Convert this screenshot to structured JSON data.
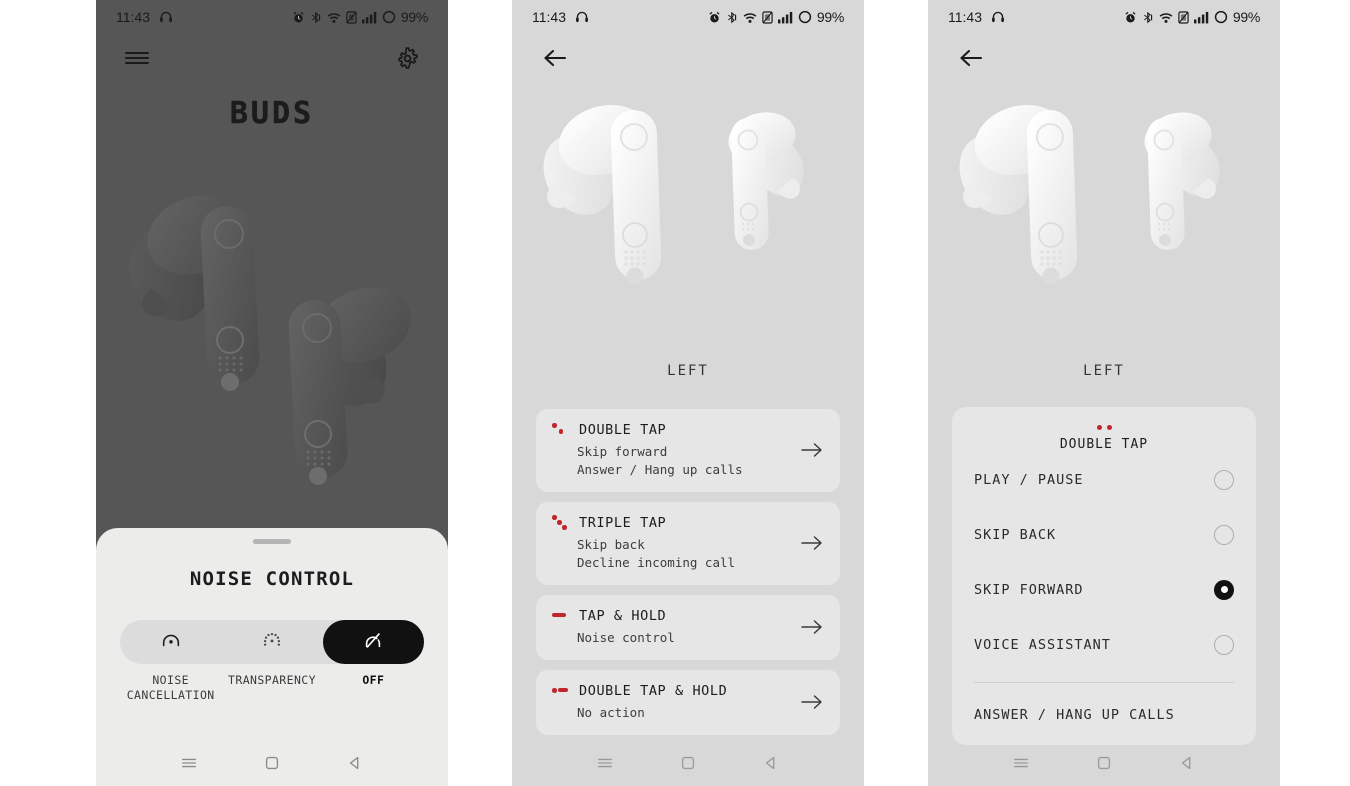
{
  "status_bar": {
    "time": "11:43",
    "battery": "99%",
    "icons": [
      "headphones-icon",
      "alarm-icon",
      "bluetooth-icon",
      "wifi-icon",
      "nfc-icon",
      "signal-icon",
      "battery-ring-icon"
    ]
  },
  "colors": {
    "dark_bg": "#565656",
    "light_bg": "#d8d8d8",
    "card_bg": "#e6e6e6",
    "sheet_bg": "#ececeb",
    "accent_red": "#c0262b",
    "selected_black": "#111111"
  },
  "panel1": {
    "menu_icon": "hamburger-menu-icon",
    "settings_icon": "gear-icon",
    "logo": "BUDS",
    "product_image": "earbuds-pair-image",
    "sheet": {
      "title": "NOISE CONTROL",
      "options": [
        {
          "label": "NOISE CANCELLATION",
          "icon": "noise-cancellation-icon",
          "selected": false
        },
        {
          "label": "TRANSPARENCY",
          "icon": "transparency-icon",
          "selected": false
        },
        {
          "label": "OFF",
          "icon": "noise-off-icon",
          "selected": true
        }
      ]
    }
  },
  "panel2": {
    "back_icon": "arrow-left-icon",
    "product_image": "earbuds-pair-image",
    "bud_label": "LEFT",
    "gestures": [
      {
        "title": "DOUBLE TAP",
        "lines": [
          "Skip forward",
          "Answer / Hang up calls"
        ],
        "icon": "two-dots-icon",
        "dots": 2,
        "hold": false,
        "arrow": "arrow-right-icon"
      },
      {
        "title": "TRIPLE TAP",
        "lines": [
          "Skip back",
          "Decline incoming call"
        ],
        "icon": "three-dots-icon",
        "dots": 3,
        "hold": false,
        "arrow": "arrow-right-icon"
      },
      {
        "title": "TAP & HOLD",
        "lines": [
          "Noise control"
        ],
        "icon": "dot-dash-icon",
        "dots": 0,
        "hold": true,
        "arrow": "arrow-right-icon"
      },
      {
        "title": "DOUBLE TAP & HOLD",
        "lines": [
          "No action"
        ],
        "icon": "dot-dot-dash-icon",
        "dots": 1,
        "hold": true,
        "arrow": "arrow-right-icon"
      }
    ]
  },
  "panel3": {
    "back_icon": "arrow-left-icon",
    "product_image": "earbuds-pair-image",
    "bud_label": "LEFT",
    "card": {
      "title": "DOUBLE TAP",
      "icon": "two-dots-icon",
      "options": [
        {
          "label": "PLAY / PAUSE",
          "selected": false
        },
        {
          "label": "SKIP BACK",
          "selected": false
        },
        {
          "label": "SKIP FORWARD",
          "selected": true
        },
        {
          "label": "VOICE ASSISTANT",
          "selected": false
        }
      ],
      "footer": "ANSWER / HANG UP CALLS"
    }
  },
  "nav_bar": {
    "recents": "recents-icon",
    "home": "home-icon",
    "back": "back-icon"
  }
}
